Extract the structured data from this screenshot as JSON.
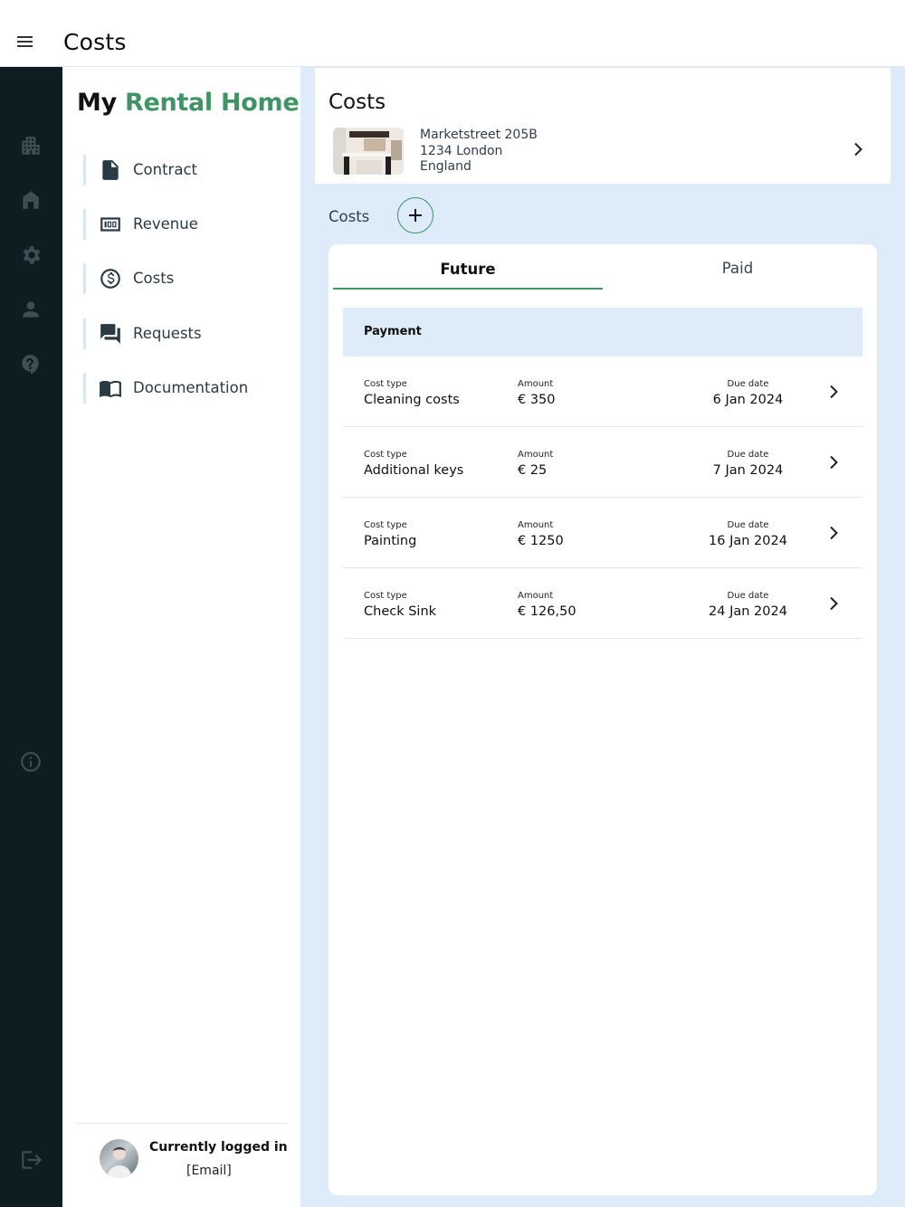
{
  "header": {
    "title": "Costs"
  },
  "drawer": {
    "brand": {
      "part1": "My",
      "part2": "Rental Home"
    },
    "items": [
      {
        "label": "Contract",
        "icon": "document-icon"
      },
      {
        "label": "Revenue",
        "icon": "money-icon"
      },
      {
        "label": "Costs",
        "icon": "dollar-circle-icon"
      },
      {
        "label": "Requests",
        "icon": "chat-icon"
      },
      {
        "label": "Documentation",
        "icon": "book-icon"
      }
    ],
    "user": {
      "status": "Currently logged in",
      "email": "[Email]"
    }
  },
  "rail": {
    "icons": [
      "buildings-icon",
      "home-icon",
      "settings-icon",
      "person-icon",
      "help-icon",
      "info-icon",
      "logout-icon"
    ]
  },
  "property": {
    "title": "Costs",
    "address_line1": "Marketstreet 205B",
    "address_line2": "1234 London",
    "address_line3": "England"
  },
  "costs": {
    "label": "Costs",
    "tabs": [
      {
        "label": "Future"
      },
      {
        "label": "Paid"
      }
    ],
    "active_tab": "Future",
    "table_header": "Payment",
    "rows": [
      {
        "cost_type_label": "Cost type",
        "cost_type": "Cleaning costs",
        "amount_label": "Amount",
        "amount": "€ 350",
        "due_label": "Due date",
        "due_date": "6 Jan 2024"
      },
      {
        "cost_type_label": "Cost type",
        "cost_type": "Additional keys",
        "amount_label": "Amount",
        "amount": "€ 25",
        "due_label": "Due date",
        "due_date": "7 Jan 2024"
      },
      {
        "cost_type_label": "Cost type",
        "cost_type": "Painting",
        "amount_label": "Amount",
        "amount": "€ 1250",
        "due_label": "Due date",
        "due_date": "16 Jan 2024"
      },
      {
        "cost_type_label": "Cost type",
        "cost_type": "Check Sink",
        "amount_label": "Amount",
        "amount": "€ 126,50",
        "due_label": "Due date",
        "due_date": "24 Jan 2024"
      }
    ]
  },
  "colors": {
    "brand_green": "#3f9365",
    "rail_bg": "#0d1d21",
    "main_bg": "#deebf9",
    "nav_text": "#2a3a45"
  }
}
